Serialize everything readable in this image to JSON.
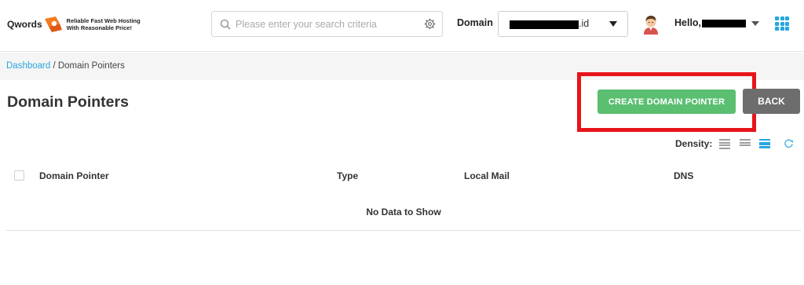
{
  "header": {
    "logo_word": "Qwords",
    "logo_tagline_1": "Reliable Fast Web Hosting",
    "logo_tagline_2": "With Reasonable Price!",
    "search_placeholder": "Please enter your search criteria",
    "domain_label": "Domain",
    "domain_value": ".id",
    "greeting": "Hello,",
    "icons": {
      "search": "search-icon",
      "settings": "gear-icon",
      "avatar": "avatar",
      "apps": "apps-grid-icon"
    }
  },
  "breadcrumb": {
    "home": "Dashboard",
    "separator": " / ",
    "current": "Domain Pointers"
  },
  "page": {
    "title": "Domain Pointers",
    "create_button": "CREATE DOMAIN POINTER",
    "back_button": "BACK"
  },
  "density": {
    "label": "Density:",
    "active_option": 3
  },
  "table": {
    "columns": [
      "Domain Pointer",
      "Type",
      "Local Mail",
      "DNS"
    ],
    "empty_message": "No Data to Show"
  },
  "colors": {
    "accent": "#27a7df",
    "create_button": "#5bbf72",
    "back_button": "#6d6d6d",
    "highlight": "#e8141b"
  }
}
